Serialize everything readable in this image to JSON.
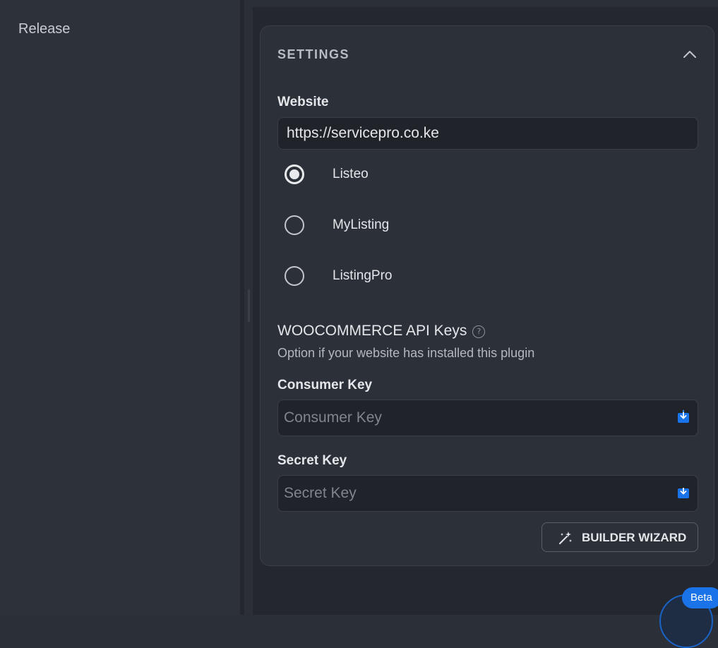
{
  "sidebar": {
    "release_label": "Release"
  },
  "settings": {
    "title": "SETTINGS",
    "website": {
      "label": "Website",
      "value": "https://servicepro.co.ke"
    },
    "platforms": [
      {
        "label": "Listeo",
        "selected": true
      },
      {
        "label": "MyListing",
        "selected": false
      },
      {
        "label": "ListingPro",
        "selected": false
      }
    ],
    "woocommerce": {
      "title": "WOOCOMMERCE API Keys",
      "help_icon": "question-circle-icon",
      "description": "Option if your website has installed this plugin"
    },
    "consumer_key": {
      "label": "Consumer Key",
      "placeholder": "Consumer Key",
      "icon": "save-icon"
    },
    "secret_key": {
      "label": "Secret Key",
      "placeholder": "Secret Key",
      "icon": "save-icon"
    },
    "wizard_button": {
      "label": "BUILDER WIZARD",
      "icon": "magic-wand-icon"
    }
  },
  "assistant": {
    "badge": "Beta"
  },
  "colors": {
    "accent": "#1a73e8",
    "panel_bg": "#2c3038",
    "input_bg": "#202329"
  }
}
